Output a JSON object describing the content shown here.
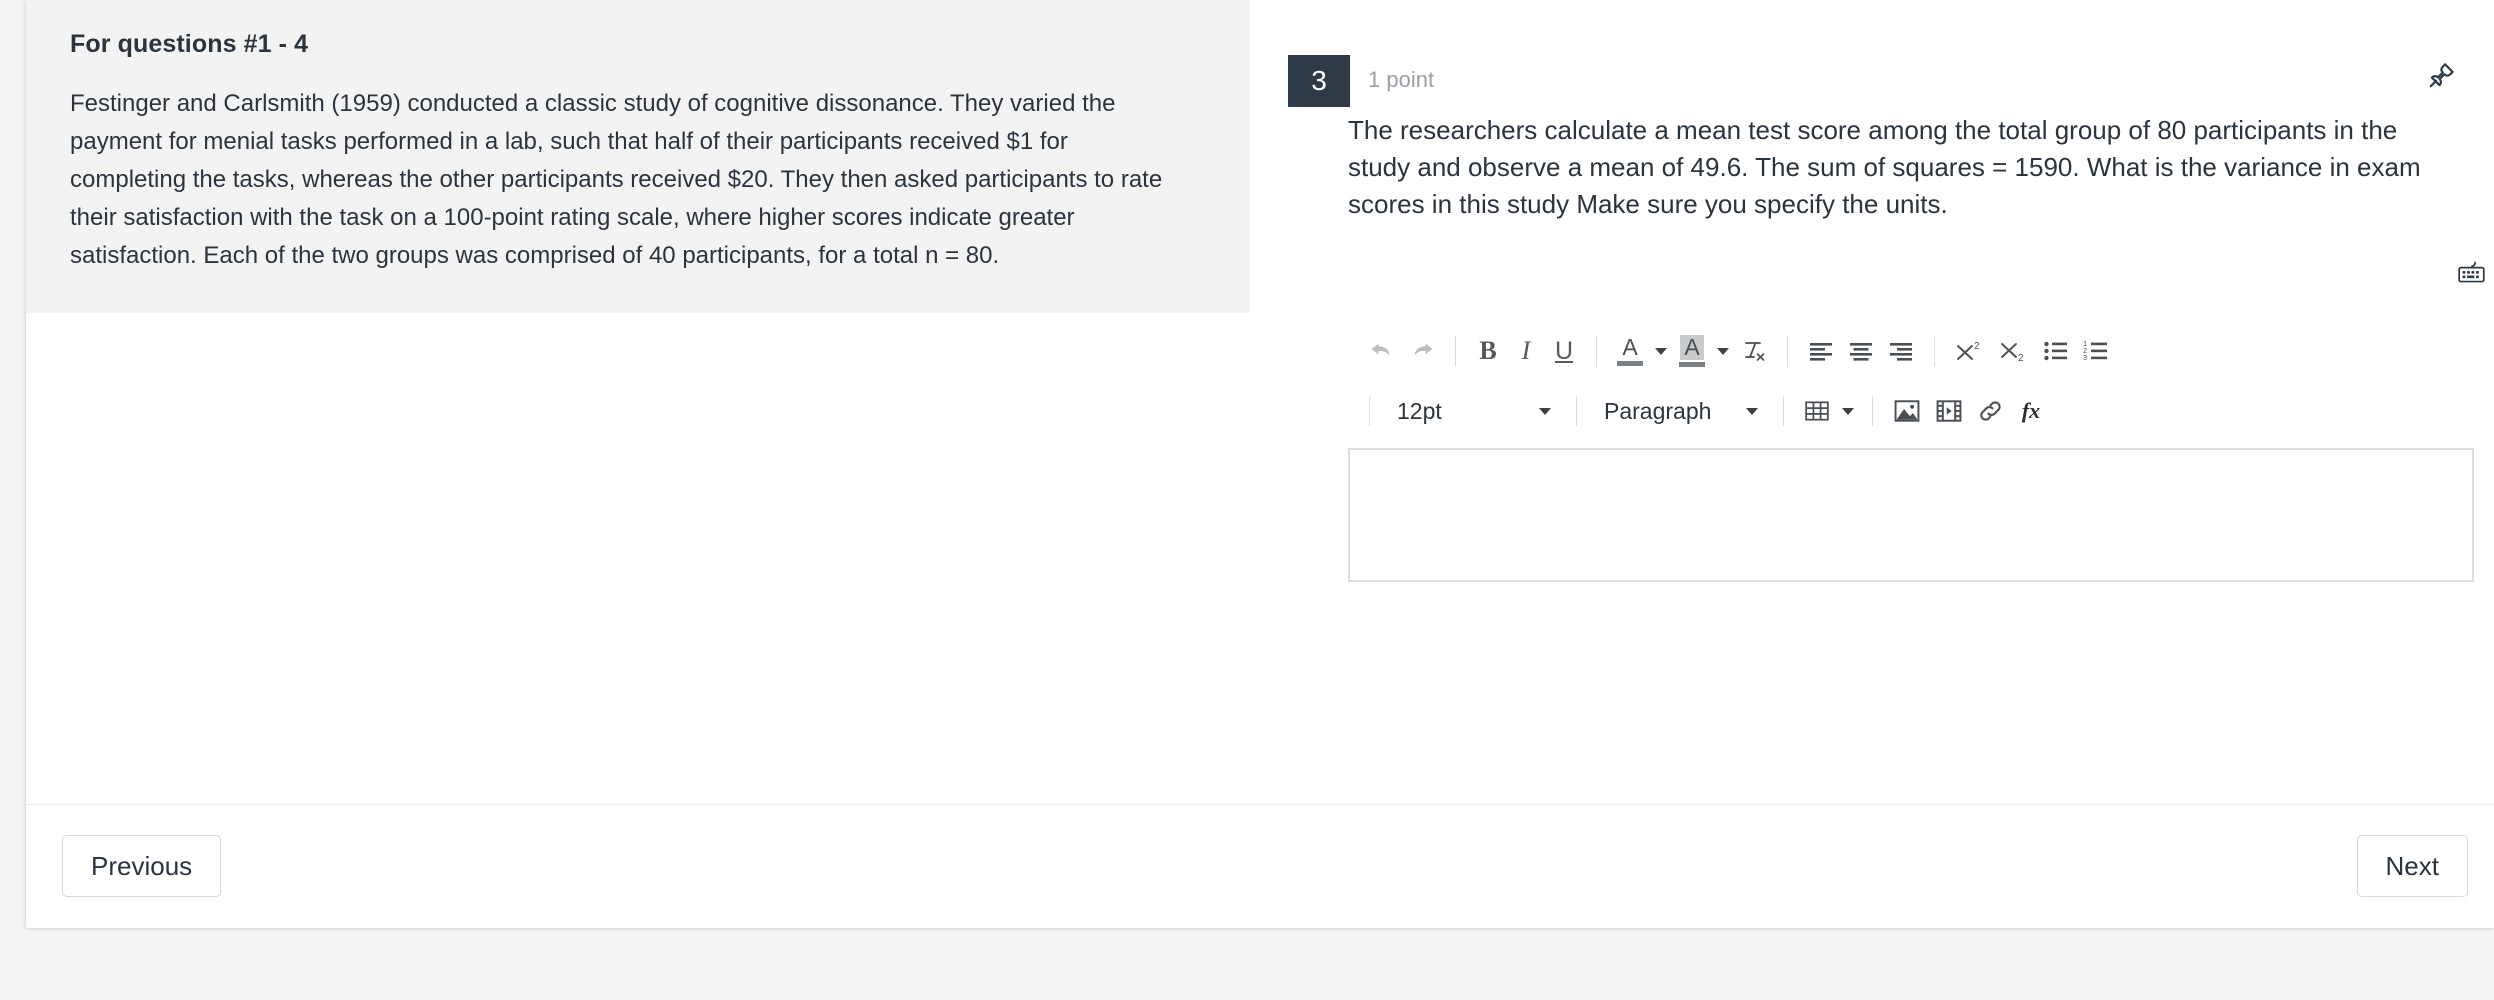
{
  "stimulus": {
    "title": "For questions #1 - 4",
    "text": "Festinger and Carlsmith (1959) conducted a classic study of cognitive dissonance. They varied the payment for menial tasks performed in a lab, such that half of their participants received $1 for completing the tasks, whereas the other participants received $20. They then asked participants to rate their satisfaction with the task on a 100-point rating scale, where higher scores indicate greater satisfaction. Each of the two groups was comprised of 40 participants, for a total n = 80."
  },
  "question": {
    "number": "3",
    "points": "1 point",
    "prompt": "The researchers calculate a mean test score among the total group of 80 participants in the study and observe a mean of 49.6. The sum of squares = 1590. What is the variance in exam scores in this study Make sure you specify the units.",
    "pin_icon": "pushpin-icon",
    "keyboard_icon": "keyboard-icon"
  },
  "editor": {
    "content": "",
    "toolbar": {
      "undo": "undo-icon",
      "redo": "redo-icon",
      "bold": "B",
      "italic": "I",
      "underline": "U",
      "text_color": "A",
      "background_color": "A",
      "clear_formatting": "remove-formatting-icon",
      "align_left": "align-left-icon",
      "align_center": "align-center-icon",
      "align_right": "align-right-icon",
      "superscript": "superscript-icon",
      "subscript": "subscript-icon",
      "bullet_list": "bullet-list-icon",
      "numbered_list": "numbered-list-icon",
      "font_size": "12pt",
      "block_format": "Paragraph",
      "table": "table-icon",
      "image": "image-icon",
      "video": "video-icon",
      "link": "link-icon",
      "equation": "fx"
    },
    "resize_grip": "resize-grip-icon"
  },
  "footer": {
    "previous_label": "Previous",
    "next_label": "Next"
  },
  "colors": {
    "badge_bg": "#2e3b47",
    "stimulus_bg": "#f3f3f4",
    "page_bg": "#f4f4f5",
    "text": "#2b343d",
    "muted": "#9aa0a6",
    "border": "#d7d8da"
  }
}
